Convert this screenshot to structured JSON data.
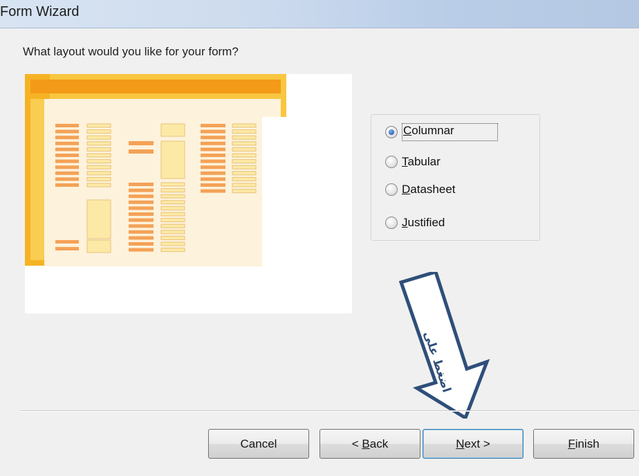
{
  "window": {
    "title": "Form Wizard"
  },
  "prompt": "What layout would you like for your form?",
  "layout_options": [
    {
      "pre": "",
      "hotkey": "C",
      "rest": "olumnar",
      "selected": true
    },
    {
      "pre": "",
      "hotkey": "T",
      "rest": "abular",
      "selected": false
    },
    {
      "pre": "",
      "hotkey": "D",
      "rest": "atasheet",
      "selected": false
    },
    {
      "pre": "",
      "hotkey": "J",
      "rest": "ustified",
      "selected": false
    }
  ],
  "buttons": {
    "cancel": "Cancel",
    "back": {
      "pre": "< ",
      "hotkey": "B",
      "rest": "ack"
    },
    "next": {
      "pre": "",
      "hotkey": "N",
      "rest": "ext >"
    },
    "finish": {
      "pre": "",
      "hotkey": "F",
      "rest": "inish"
    }
  },
  "annotation": {
    "text": "اضغط على",
    "color": "#2f4f7a"
  },
  "colors": {
    "preview_frame": "#f5b324",
    "preview_label": "#f4a257",
    "preview_field": "#fde9a6"
  }
}
